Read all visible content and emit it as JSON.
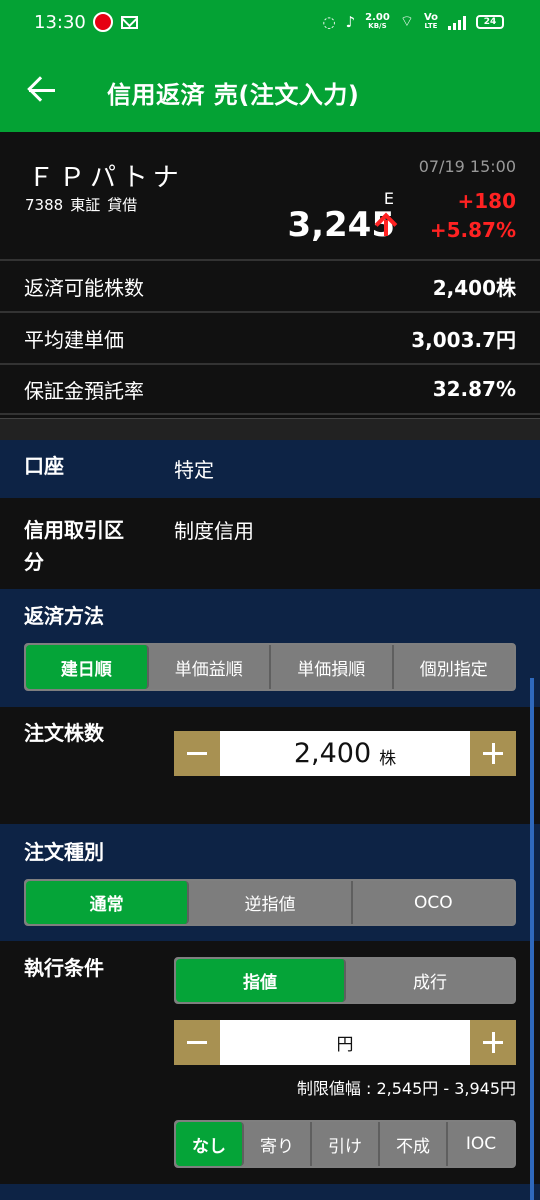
{
  "status": {
    "time": "13:30",
    "network": "2.00",
    "network_unit": "KB/S",
    "battery": "24",
    "vo": "Vo",
    "lte": "LTE"
  },
  "appbar": {
    "title": "信用返済 売(注文入力)"
  },
  "stock": {
    "name": "ＦＰパトナ",
    "code": "7388",
    "market": "東証",
    "type": "貸借",
    "timestamp": "07/19 15:00",
    "indicator": "E",
    "price": "3,245",
    "change": "+180",
    "change_pct": "+5.87%"
  },
  "summary": [
    {
      "label": "返済可能株数",
      "value": "2,400株"
    },
    {
      "label": "平均建単価",
      "value": "3,003.7円"
    },
    {
      "label": "保証金預託率",
      "value": "32.87%"
    }
  ],
  "account": {
    "label": "口座",
    "value": "特定"
  },
  "credit": {
    "label": "信用取引区分",
    "value": "制度信用"
  },
  "repayment": {
    "label": "返済方法",
    "options": [
      "建日順",
      "単価益順",
      "単価損順",
      "個別指定"
    ],
    "selected": "建日順"
  },
  "quantity": {
    "label": "注文株数",
    "value": "2,400",
    "unit": "株"
  },
  "order_type": {
    "label": "注文種別",
    "options": [
      "通常",
      "逆指値",
      "OCO"
    ],
    "selected": "通常"
  },
  "execution": {
    "label": "執行条件",
    "options": [
      "指値",
      "成行"
    ],
    "selected": "指値",
    "price_unit": "円",
    "limit_range": "制限値幅 : 2,545円 - 3,945円",
    "conditions": [
      "なし",
      "寄り",
      "引け",
      "不成",
      "IOC"
    ],
    "condition_selected": "なし"
  },
  "colors": {
    "brand": "#04a234",
    "blue_section": "#0d2345",
    "accent": "#a89152",
    "up": "#ff2222"
  },
  "icons": {
    "back": "back-arrow-icon",
    "up": "up-arrow-icon"
  }
}
